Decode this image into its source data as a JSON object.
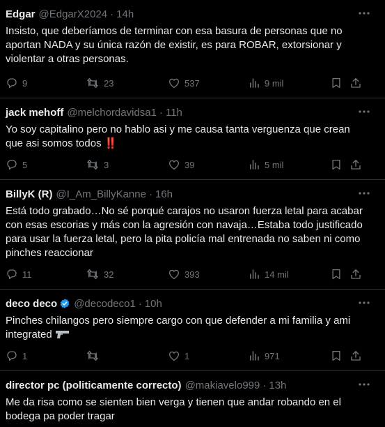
{
  "tweets": [
    {
      "name": "Edgar",
      "handle": "@EdgarX2024",
      "dot": "·",
      "time": "14h",
      "verified": false,
      "text": "Insisto, que deberíamos de terminar con esa basura de personas que no aportan NADA  y su única razón de existir, es para ROBAR, extorsionar y violentar a otras personas.",
      "replies": "9",
      "retweets": "23",
      "likes": "537",
      "views": "9 mil"
    },
    {
      "name": "jack mehoff",
      "handle": "@melchordavidsa1",
      "dot": "·",
      "time": "11h",
      "verified": false,
      "text": "Yo soy capitalino pero no hablo asi y me causa tanta verguenza que crean que asi somos todos ‼️",
      "replies": "5",
      "retweets": "3",
      "likes": "39",
      "views": "5 mil"
    },
    {
      "name": "BillyK (R)",
      "handle": "@I_Am_BillyKanne",
      "dot": "·",
      "time": "16h",
      "verified": false,
      "text": "Está todo grabado…No sé porqué carajos no usaron fuerza letal para acabar con esas escorias y más con la agresión con navaja…Estaba todo justificado para usar la fuerza letal, pero la pita policía mal entrenada no saben ni como pinches reaccionar",
      "replies": "11",
      "retweets": "32",
      "likes": "393",
      "views": "14 mil"
    },
    {
      "name": "deco deco",
      "handle": "@decodeco1",
      "dot": "·",
      "time": "10h",
      "verified": true,
      "text": "Pinches chilangos pero siempre cargo con que defender a mi familia y ami integrated",
      "replies": "1",
      "retweets": "",
      "likes": "1",
      "views": "971"
    },
    {
      "name": "director pc (politicamente correcto)",
      "handle": "@makiavelo999",
      "dot": "·",
      "time": "13h",
      "verified": false,
      "text": "Me da risa como se sienten bien verga y tienen que andar robando  en el bodega pa poder tragar"
    }
  ],
  "colors": {
    "background": "#000000",
    "text": "#e7e9ea",
    "muted": "#71767b",
    "divider": "#2f3336",
    "verified": "#1d9bf0"
  },
  "icons": [
    "reply-icon",
    "retweet-icon",
    "like-icon",
    "views-icon",
    "bookmark-icon",
    "share-icon",
    "more-icon",
    "verified-icon",
    "pistol-emoji"
  ]
}
